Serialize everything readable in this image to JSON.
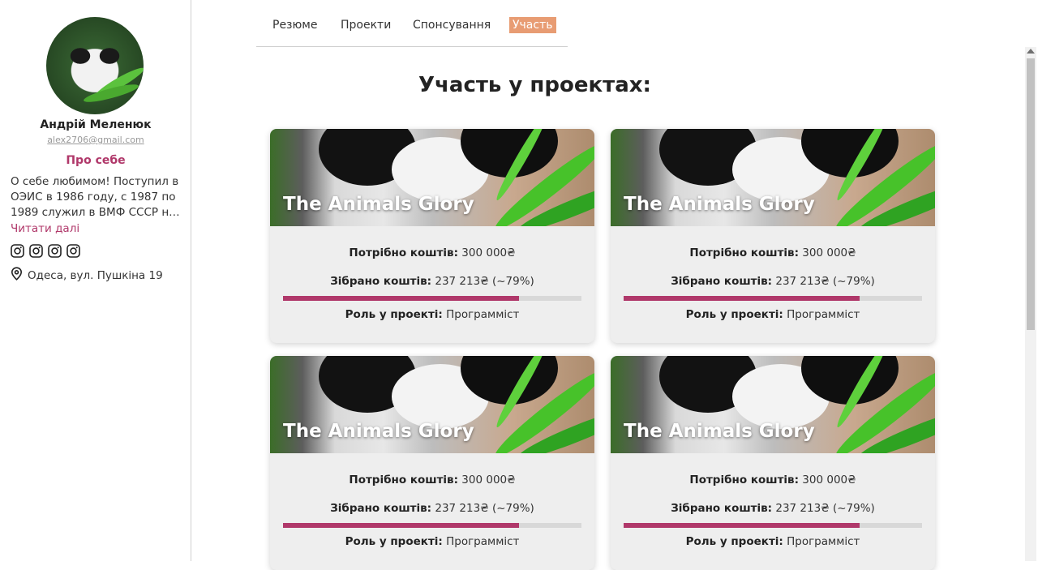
{
  "profile": {
    "name": "Андрій Меленюк",
    "email": "alex2706@gmail.com",
    "about_title": "Про себе",
    "about_text": "О себе любимом! Поступил в ОЭИС в 1986 году, с 1987 по 1989 служил в ВМФ СССР на Северном флоте...",
    "read_more": "Читати далі",
    "address": "Одеса, вул. Пушкіна 19",
    "socials": [
      "instagram-icon",
      "instagram-icon",
      "instagram-icon",
      "instagram-icon"
    ]
  },
  "nav": {
    "tabs": [
      {
        "label": "Резюме",
        "active": false
      },
      {
        "label": "Проекти",
        "active": false
      },
      {
        "label": "Спонсування",
        "active": false
      },
      {
        "label": "Участь",
        "active": true
      }
    ]
  },
  "main": {
    "title": "Участь у проектах:",
    "cards": [
      {
        "title": "The Animals Glory",
        "needed_label": "Потрібно коштів:",
        "needed_value": "300 000₴",
        "raised_label": "Зібрано коштів:",
        "raised_value": "237 213₴ (~79%)",
        "progress": 0.79,
        "role_label": "Роль у проекті:",
        "role_value": "Программіст"
      },
      {
        "title": "The Animals Glory",
        "needed_label": "Потрібно коштів:",
        "needed_value": "300 000₴",
        "raised_label": "Зібрано коштів:",
        "raised_value": "237 213₴ (~79%)",
        "progress": 0.79,
        "role_label": "Роль у проекті:",
        "role_value": "Программіст"
      },
      {
        "title": "The Animals Glory",
        "needed_label": "Потрібно коштів:",
        "needed_value": "300 000₴",
        "raised_label": "Зібрано коштів:",
        "raised_value": "237 213₴ (~79%)",
        "progress": 0.79,
        "role_label": "Роль у проекті:",
        "role_value": "Программіст"
      },
      {
        "title": "The Animals Glory",
        "needed_label": "Потрібно коштів:",
        "needed_value": "300 000₴",
        "raised_label": "Зібрано коштів:",
        "raised_value": "237 213₴ (~79%)",
        "progress": 0.79,
        "role_label": "Роль у проекті:",
        "role_value": "Программіст"
      }
    ]
  },
  "colors": {
    "accent": "#b0386a",
    "active_tab": "#e89c73",
    "card_bg": "#eeeeee"
  }
}
